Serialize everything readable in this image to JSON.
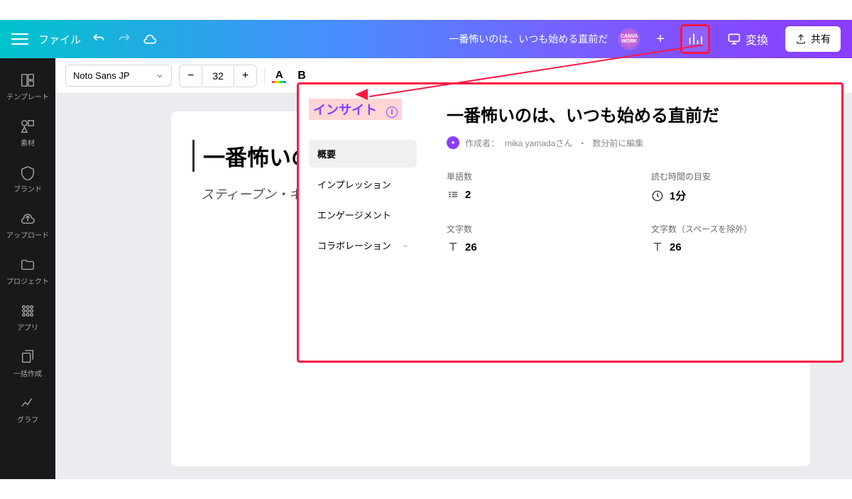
{
  "topbar": {
    "file_label": "ファイル",
    "doc_title": "一番怖いのは、いつも始める直前だ",
    "badge": "CANVA WORK",
    "convert_label": "変換",
    "share_label": "共有"
  },
  "sidebar": {
    "items": [
      {
        "label": "テンプレート"
      },
      {
        "label": "素材"
      },
      {
        "label": "ブランド"
      },
      {
        "label": "アップロード"
      },
      {
        "label": "プロジェクト"
      },
      {
        "label": "アプリ"
      },
      {
        "label": "一括作成"
      },
      {
        "label": "グラフ"
      }
    ]
  },
  "toolbar": {
    "font": "Noto Sans JP",
    "size": "32",
    "minus": "−",
    "plus": "+",
    "color_a": "A",
    "bold": "B"
  },
  "document": {
    "heading": "一番怖いのは、いつも始める直前だ",
    "subtitle": "スティーブン・キング"
  },
  "insight": {
    "title": "インサイト",
    "nav": [
      {
        "label": "概要",
        "active": true
      },
      {
        "label": "インプレッション"
      },
      {
        "label": "エンゲージメント"
      },
      {
        "label": "コラボレーション",
        "expandable": true
      }
    ],
    "heading": "一番怖いのは、いつも始める直前だ",
    "author_prefix": "作成者：",
    "author": "mika yamadaさん",
    "sep": "・",
    "edited": "数分前に編集",
    "stats": {
      "words_label": "単語数",
      "words": "2",
      "readtime_label": "読む時間の目安",
      "readtime": "1分",
      "chars_label": "文字数",
      "chars": "26",
      "chars_nospace_label": "文字数（スペースを除外）",
      "chars_nospace": "26"
    }
  }
}
